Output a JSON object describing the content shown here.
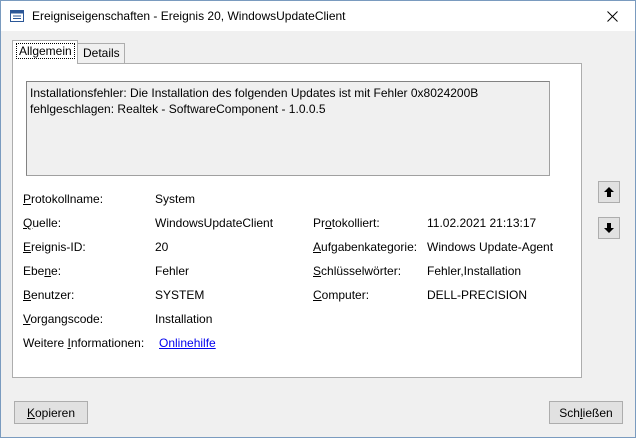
{
  "window": {
    "title": "Ereigniseigenschaften - Ereignis 20, WindowsUpdateClient",
    "app_icon": "event-viewer-icon",
    "close_icon": "close-icon"
  },
  "tabs": [
    {
      "label": "Allgemein",
      "selected": true
    },
    {
      "label": "Details",
      "selected": false
    }
  ],
  "description": {
    "line1": "Installationsfehler: Die Installation des folgenden Updates ist mit Fehler 0x8024200B",
    "line2": "fehlgeschlagen: Realtek - SoftwareComponent - 1.0.0.5"
  },
  "fields": {
    "protokollname": {
      "label_acc": "P",
      "label_rest": "rotokollname:",
      "value": "System"
    },
    "quelle": {
      "label_acc": "Q",
      "label_rest": "uelle:",
      "value": "WindowsUpdateClient"
    },
    "protokolliert": {
      "label_pre": "Pr",
      "label_acc": "o",
      "label_rest": "tokolliert:",
      "value": "11.02.2021 21:13:17"
    },
    "ereignis_id": {
      "label_acc": "E",
      "label_rest": "reignis-ID:",
      "value": "20"
    },
    "aufgabenkategorie": {
      "label_acc": "A",
      "label_rest": "ufgabenkategorie:",
      "value": "Windows Update-Agent"
    },
    "ebene": {
      "label_pre": "Ebe",
      "label_acc": "n",
      "label_rest": "e:",
      "value": "Fehler"
    },
    "schluesselwoerter": {
      "label_acc": "S",
      "label_rest": "chlüsselwörter:",
      "value": "Fehler,Installation"
    },
    "benutzer": {
      "label_acc": "B",
      "label_rest": "enutzer:",
      "value": "SYSTEM"
    },
    "computer": {
      "label_acc": "C",
      "label_rest": "omputer:",
      "value": "DELL-PRECISION"
    },
    "vorgangscode": {
      "label_acc": "V",
      "label_rest": "organgscode:",
      "value": "Installation"
    },
    "weitere": {
      "label_pre": "Weitere ",
      "label_acc": "I",
      "label_rest": "nformationen:",
      "link": "Onlinehilfe"
    }
  },
  "side_buttons": {
    "up_icon": "arrow-up-icon",
    "down_icon": "arrow-down-icon"
  },
  "buttons": {
    "copy_acc": "K",
    "copy_rest": "opieren",
    "close_pre": "Sch",
    "close_acc": "l",
    "close_rest": "ießen"
  }
}
